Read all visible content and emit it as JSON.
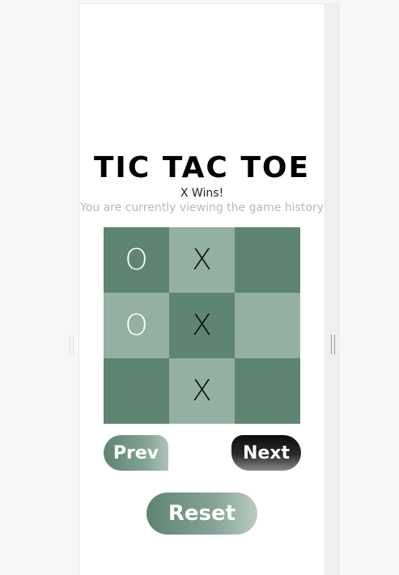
{
  "title": "TIC TAC TOE",
  "status": "X Wins!",
  "history_note": "You are currently viewing the game history",
  "board": {
    "cells": [
      {
        "value": "O",
        "shade": "dark"
      },
      {
        "value": "X",
        "shade": "light"
      },
      {
        "value": "",
        "shade": "dark"
      },
      {
        "value": "O",
        "shade": "light"
      },
      {
        "value": "X",
        "shade": "dark"
      },
      {
        "value": "",
        "shade": "light"
      },
      {
        "value": "",
        "shade": "dark"
      },
      {
        "value": "X",
        "shade": "light"
      },
      {
        "value": "",
        "shade": "dark"
      }
    ]
  },
  "controls": {
    "prev_label": "Prev",
    "next_label": "Next",
    "reset_label": "Reset"
  },
  "colors": {
    "dark_cell": "#5e8472",
    "light_cell": "#94b0a3",
    "o_mark": "#ffffff",
    "x_mark": "#111111"
  }
}
